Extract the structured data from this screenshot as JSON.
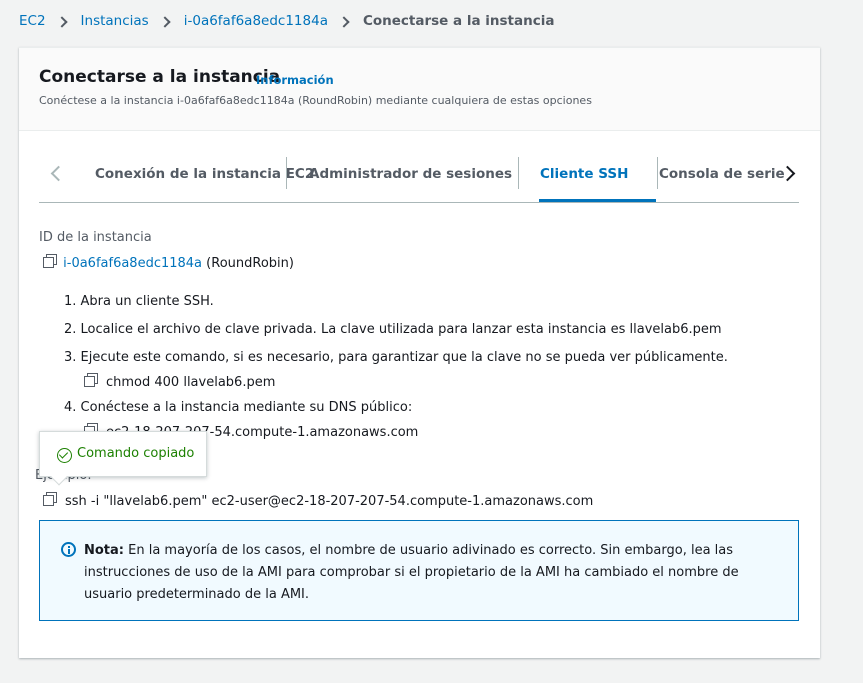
{
  "breadcrumb": {
    "items": [
      "EC2",
      "Instancias",
      "i-0a6faf6a8edc1184a"
    ],
    "current": "Conectarse a la instancia"
  },
  "header": {
    "title": "Conectarse a la instancia",
    "info_link": "Información",
    "description": "Conéctese a la instancia i-0a6faf6a8edc1184a (RoundRobin) mediante cualquiera de estas opciones"
  },
  "tabs": [
    {
      "label": "Conexión de la instancia EC2",
      "active": false
    },
    {
      "label": "Administrador de sesiones",
      "active": false
    },
    {
      "label": "Cliente SSH",
      "active": true
    },
    {
      "label": "Consola de serie",
      "active": false
    }
  ],
  "instance": {
    "label": "ID de la instancia",
    "id": "i-0a6faf6a8edc1184a",
    "name": "(RoundRobin)"
  },
  "steps": [
    "1. Abra un cliente SSH.",
    "2. Localice el archivo de clave privada. La clave utilizada para lanzar esta instancia es llavelab6.pem",
    "3. Ejecute este comando, si es necesario, para garantizar que la clave no se pueda ver públicamente.",
    "4. Conéctese a la instancia mediante su DNS público:"
  ],
  "chmod_command": "chmod 400 llavelab6.pem",
  "public_dns": "ec2-18-207-207-54.compute-1.amazonaws.com",
  "example_label": "Ejemplo:",
  "ssh_command": "ssh -i \"llavelab6.pem\" ec2-user@ec2-18-207-207-54.compute-1.amazonaws.com",
  "note": {
    "label": "Nota:",
    "text": " En la mayoría de los casos, el nombre de usuario adivinado es correcto. Sin embargo, lea las instrucciones de uso de la AMI para comprobar si el propietario de la AMI ha cambiado el nombre de usuario predeterminado de la AMI."
  },
  "popover": {
    "text": "Comando copiado"
  },
  "colors": {
    "link": "#0073bb",
    "success": "#1d8102",
    "note_bg": "#f1faff"
  }
}
